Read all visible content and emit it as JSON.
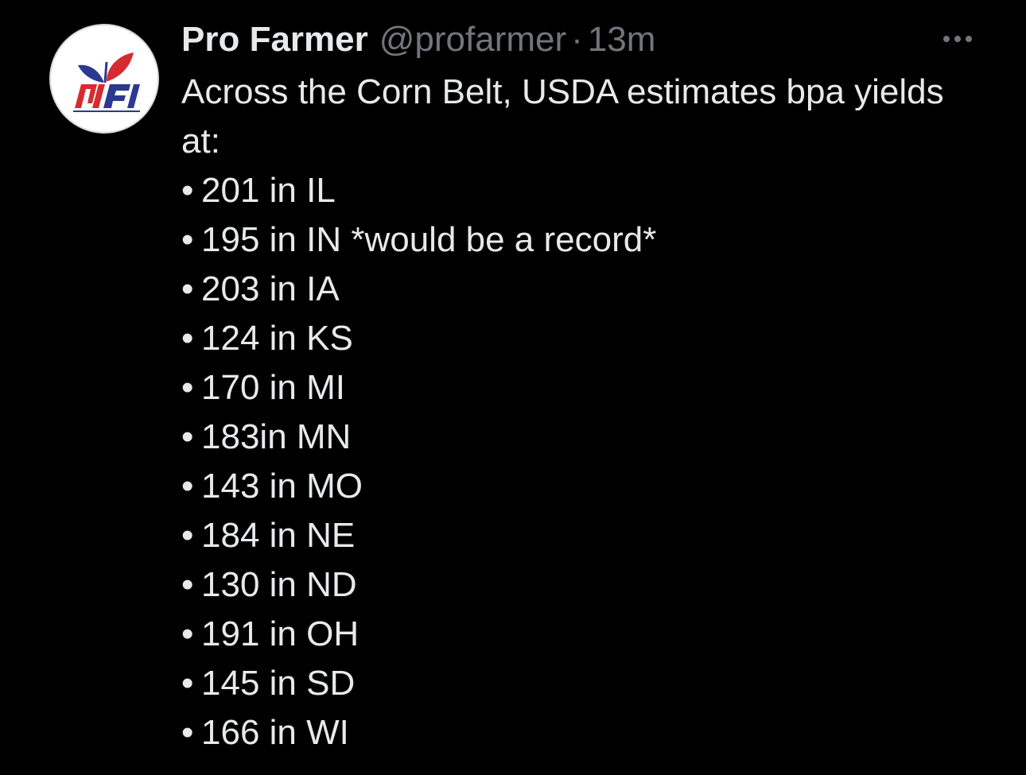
{
  "tweet": {
    "author": {
      "display_name": "Pro Farmer",
      "handle": "@profarmer",
      "separator": "·",
      "timestamp": "13m",
      "avatar_icon": "pro-farmer-logo",
      "avatar_colors": {
        "red": "#d62b30",
        "blue": "#2b3990",
        "background": "#ffffff"
      }
    },
    "more_icon": "more-horizontal-icon",
    "intro": "Across the Corn Belt, USDA estimates bpa yields at:",
    "bullet": "•",
    "items": [
      "201 in IL",
      "195 in IN *would be a record*",
      "203 in IA",
      "124 in KS",
      "170 in MI",
      "183in MN",
      "143 in MO",
      "184 in NE",
      "130 in ND",
      "191 in OH",
      "145 in SD",
      "166 in WI"
    ]
  },
  "theme": {
    "background": "#000000",
    "text": "#e7e9ea",
    "secondary_text": "#71767b"
  }
}
